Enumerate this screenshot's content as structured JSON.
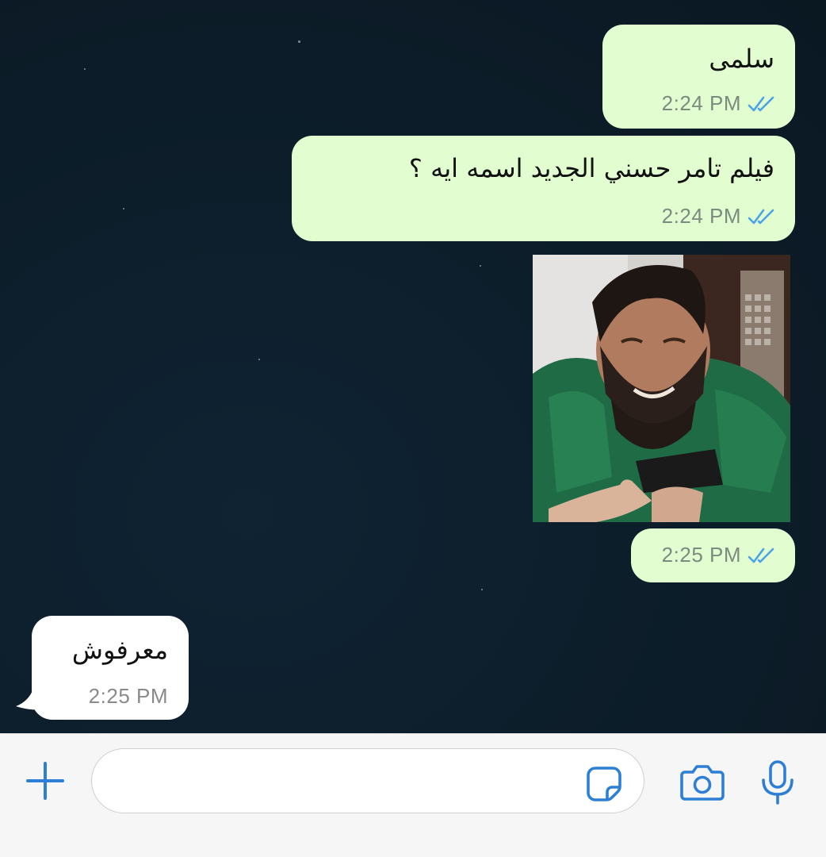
{
  "conversation": {
    "messages": [
      {
        "direction": "outgoing",
        "text": "سلمى",
        "time": "2:24 PM",
        "status": "read"
      },
      {
        "direction": "outgoing",
        "text": "فيلم تامر حسني الجديد اسمه ايه ؟",
        "time": "2:24 PM",
        "status": "read"
      },
      {
        "direction": "outgoing",
        "type": "photo",
        "time": "2:25 PM",
        "status": "read"
      },
      {
        "direction": "incoming",
        "text": "معرفوش",
        "time": "2:25 PM"
      }
    ]
  },
  "composer": {
    "input_value": "",
    "icons": [
      "plus-icon",
      "sticker-icon",
      "camera-icon",
      "microphone-icon"
    ]
  },
  "colors": {
    "chat_background": "#0d1e2b",
    "outgoing_bubble": "#e2fdd0",
    "incoming_bubble": "#ffffff",
    "accent_blue": "#2d7fd6",
    "read_ticks": "#4aa3e6"
  }
}
